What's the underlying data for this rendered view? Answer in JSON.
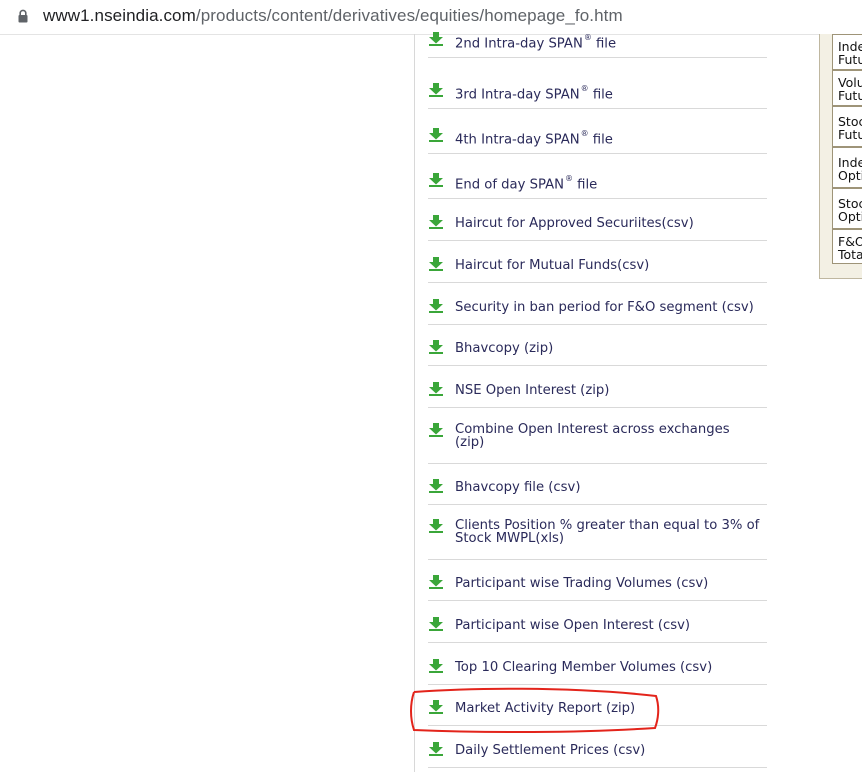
{
  "address_bar": {
    "url_host": "www1.nseindia.com",
    "url_path": "/products/content/derivatives/equities/homepage_fo.htm"
  },
  "colors": {
    "link_text": "#2a2a5a",
    "download_icon": "#3aa639",
    "annotation": "#e3241b"
  },
  "downloads": [
    {
      "label": "2nd Intra-day SPAN",
      "sup": "®",
      "suffix": " file",
      "icon": "download-arrow-icon"
    },
    {
      "label": "3rd Intra-day SPAN",
      "sup": "®",
      "suffix": " file",
      "icon": "download-arrow-icon"
    },
    {
      "label": "4th Intra-day SPAN",
      "sup": "®",
      "suffix": " file",
      "icon": "download-arrow-icon"
    },
    {
      "label": "End of day SPAN",
      "sup": "®",
      "suffix": " file",
      "icon": "download-arrow-icon"
    },
    {
      "label": "Haircut for Approved Securiites(csv)",
      "icon": "download-arrow-icon"
    },
    {
      "label": "Haircut for Mutual Funds(csv)",
      "icon": "download-arrow-icon"
    },
    {
      "label": "Security in ban period for F&O segment (csv)",
      "icon": "download-arrow-icon"
    },
    {
      "label": "Bhavcopy (zip)",
      "icon": "download-arrow-icon"
    },
    {
      "label": "NSE Open Interest (zip)",
      "icon": "download-arrow-icon"
    },
    {
      "label": "Combine Open Interest across exchanges",
      "line2": "(zip)",
      "icon": "download-arrow-icon"
    },
    {
      "label": "Bhavcopy file (csv)",
      "icon": "download-arrow-icon"
    },
    {
      "label": "Clients Position % greater than equal to 3% of",
      "line2": "Stock MWPL(xls)",
      "icon": "download-arrow-icon"
    },
    {
      "label": "Participant wise Trading Volumes (csv)",
      "icon": "download-arrow-icon"
    },
    {
      "label": "Participant wise Open Interest (csv)",
      "icon": "download-arrow-icon"
    },
    {
      "label": "Top 10 Clearing Member Volumes (csv)",
      "icon": "download-arrow-icon"
    },
    {
      "label": "Market Activity Report (zip)",
      "icon": "download-arrow-icon",
      "highlighted": true
    },
    {
      "label": "Daily Settlement Prices (csv)",
      "icon": "download-arrow-icon"
    }
  ],
  "side_table": [
    {
      "line1": "Inde",
      "line2": "Futu"
    },
    {
      "line1": "Volu",
      "line2": "Futu"
    },
    {
      "line1": "Stoc",
      "line2": "Futu"
    },
    {
      "line1": "Inde",
      "line2": "Opti"
    },
    {
      "line1": "Stoc",
      "line2": "Opti"
    },
    {
      "line1": "F&O",
      "line2": "Tota"
    }
  ]
}
